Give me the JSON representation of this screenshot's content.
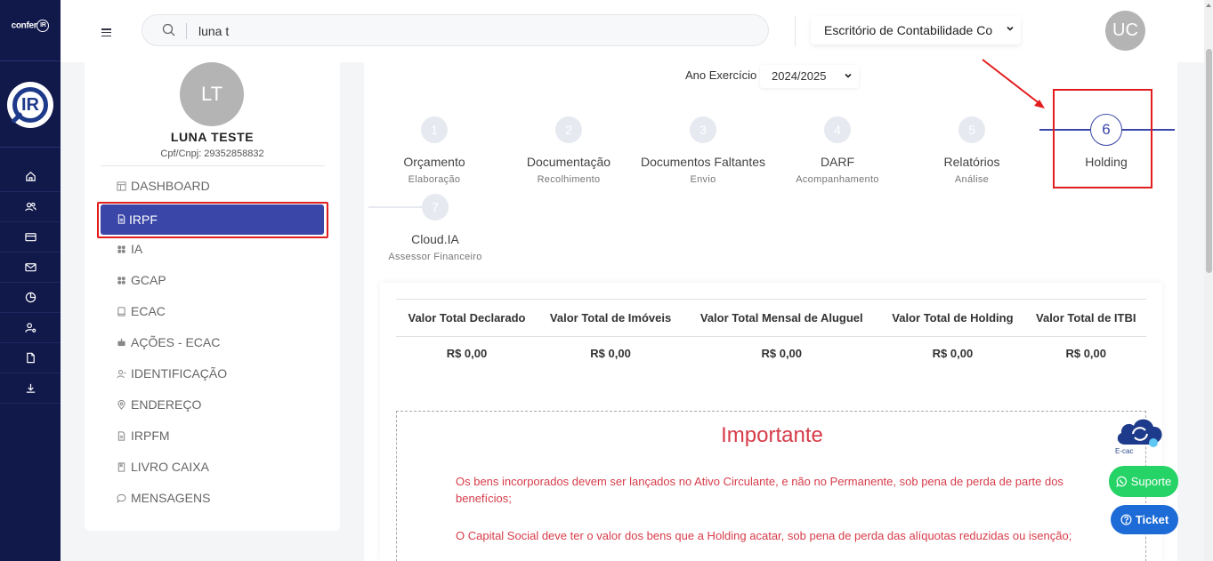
{
  "rail": {
    "brand_prefix": "confer",
    "brand_mark": "IR",
    "logo_text": "IR",
    "icons": [
      "home-icon",
      "users-icon",
      "card-icon",
      "mail-icon",
      "chart-pie-icon",
      "user-settings-icon",
      "document-icon",
      "download-icon"
    ]
  },
  "topbar": {
    "search_value": "luna t",
    "office_selected": "Escritório de Contabilidade Co",
    "user_initials": "UC"
  },
  "profile": {
    "initials": "LT",
    "name": "LUNA TESTE",
    "cpf": "Cpf/Cnpj: 29352858832"
  },
  "menu": {
    "dashboard": "DASHBOARD",
    "irpf": "IRPF",
    "ia": "IA",
    "gcap": "GCAP",
    "ecac": "ECAC",
    "acoes": "AÇÕES - ECAC",
    "identificacao": "IDENTIFICAÇÃO",
    "endereco": "ENDEREÇO",
    "irpfm": "IRPFM",
    "livro": "LIVRO CAIXA",
    "mensagens": "MENSAGENS"
  },
  "exercise": {
    "label": "Ano Exercício",
    "selected": "2024/2025"
  },
  "steps": [
    {
      "num": "1",
      "label": "Orçamento",
      "sub": "Elaboração"
    },
    {
      "num": "2",
      "label": "Documentação",
      "sub": "Recolhimento"
    },
    {
      "num": "3",
      "label": "Documentos Faltantes",
      "sub": "Envio"
    },
    {
      "num": "4",
      "label": "DARF",
      "sub": "Acompanhamento"
    },
    {
      "num": "5",
      "label": "Relatórios",
      "sub": "Análise"
    },
    {
      "num": "6",
      "label": "Holding",
      "sub": ""
    },
    {
      "num": "7",
      "label": "Cloud.IA",
      "sub": "Assessor Financeiro"
    }
  ],
  "summary_table": {
    "headers": [
      "Valor Total Declarado",
      "Valor Total de Imóveis",
      "Valor Total Mensal de Aluguel",
      "Valor Total de Holding",
      "Valor Total de ITBI"
    ],
    "values": [
      "R$ 0,00",
      "R$ 0,00",
      "R$ 0,00",
      "R$ 0,00",
      "R$ 0,00"
    ]
  },
  "importante": {
    "title": "Importante",
    "p1": "Os bens incorporados devem ser lançados no Ativo Circulante, e não no Permanente, sob pena de perda de parte dos benefícios;",
    "p2": "O Capital Social deve ter o valor dos bens que a Holding acatar, sob pena de perda das alíquotas reduzidas ou isenção;"
  },
  "widgets": {
    "ecac_label": "E-cac",
    "suporte": "Suporte",
    "ticket": "Ticket"
  },
  "colors": {
    "rail_bg": "#11184a",
    "accent": "#3a46a8",
    "highlight_red": "#e21d1d",
    "warning_text": "#d63c4a",
    "whatsapp": "#25d366",
    "ticket": "#1c6bd6"
  }
}
